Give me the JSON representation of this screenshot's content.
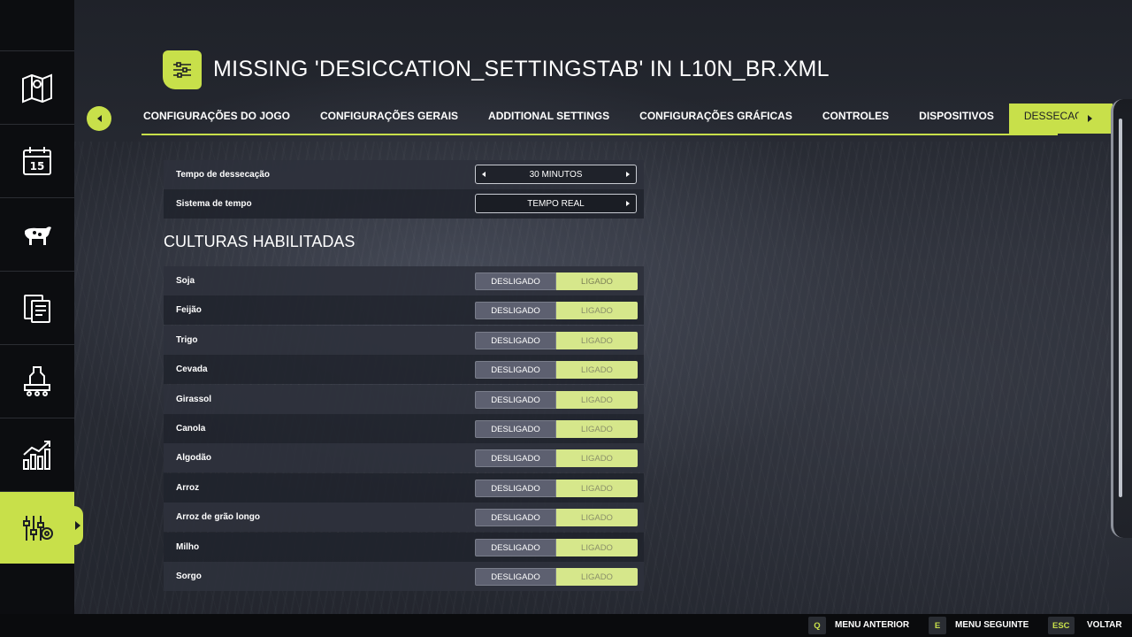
{
  "page": {
    "title": "MISSING 'DESICCATION_SETTINGSTAB' IN L10N_BR.XML"
  },
  "accent_color": "#c8e04a",
  "sidebar": {
    "items": [
      {
        "name": "map-icon"
      },
      {
        "name": "calendar-icon",
        "number": "15"
      },
      {
        "name": "animals-icon"
      },
      {
        "name": "contracts-icon"
      },
      {
        "name": "production-icon"
      },
      {
        "name": "statistics-icon"
      },
      {
        "name": "settings-icon",
        "active": true
      }
    ]
  },
  "tabs": [
    {
      "label": "CONFIGURAÇÕES DO JOGO",
      "active": false
    },
    {
      "label": "CONFIGURAÇÕES GERAIS",
      "active": false
    },
    {
      "label": "ADDITIONAL SETTINGS",
      "active": false
    },
    {
      "label": "CONFIGURAÇÕES GRÁFICAS",
      "active": false
    },
    {
      "label": "CONTROLES",
      "active": false
    },
    {
      "label": "DISPOSITIVOS",
      "active": false
    },
    {
      "label": "DESSECAÇÃO",
      "active": true
    }
  ],
  "settings": {
    "desiccation_time": {
      "label": "Tempo de dessecação",
      "value": "30 MINUTOS"
    },
    "time_system": {
      "label": "Sistema de tempo",
      "value": "TEMPO REAL"
    }
  },
  "crops": {
    "section_title": "CULTURAS HABILITADAS",
    "off_label": "DESLIGADO",
    "on_label": "LIGADO",
    "items": [
      {
        "label": "Soja"
      },
      {
        "label": "Feijão"
      },
      {
        "label": "Trigo"
      },
      {
        "label": "Cevada"
      },
      {
        "label": "Girassol"
      },
      {
        "label": "Canola"
      },
      {
        "label": "Algodão"
      },
      {
        "label": "Arroz"
      },
      {
        "label": "Arroz de grão longo"
      },
      {
        "label": "Milho"
      },
      {
        "label": "Sorgo"
      }
    ]
  },
  "footer": {
    "prev": {
      "key": "Q",
      "label": "MENU ANTERIOR"
    },
    "next": {
      "key": "E",
      "label": "MENU SEGUINTE"
    },
    "back": {
      "key": "ESC",
      "label": "VOLTAR"
    }
  }
}
